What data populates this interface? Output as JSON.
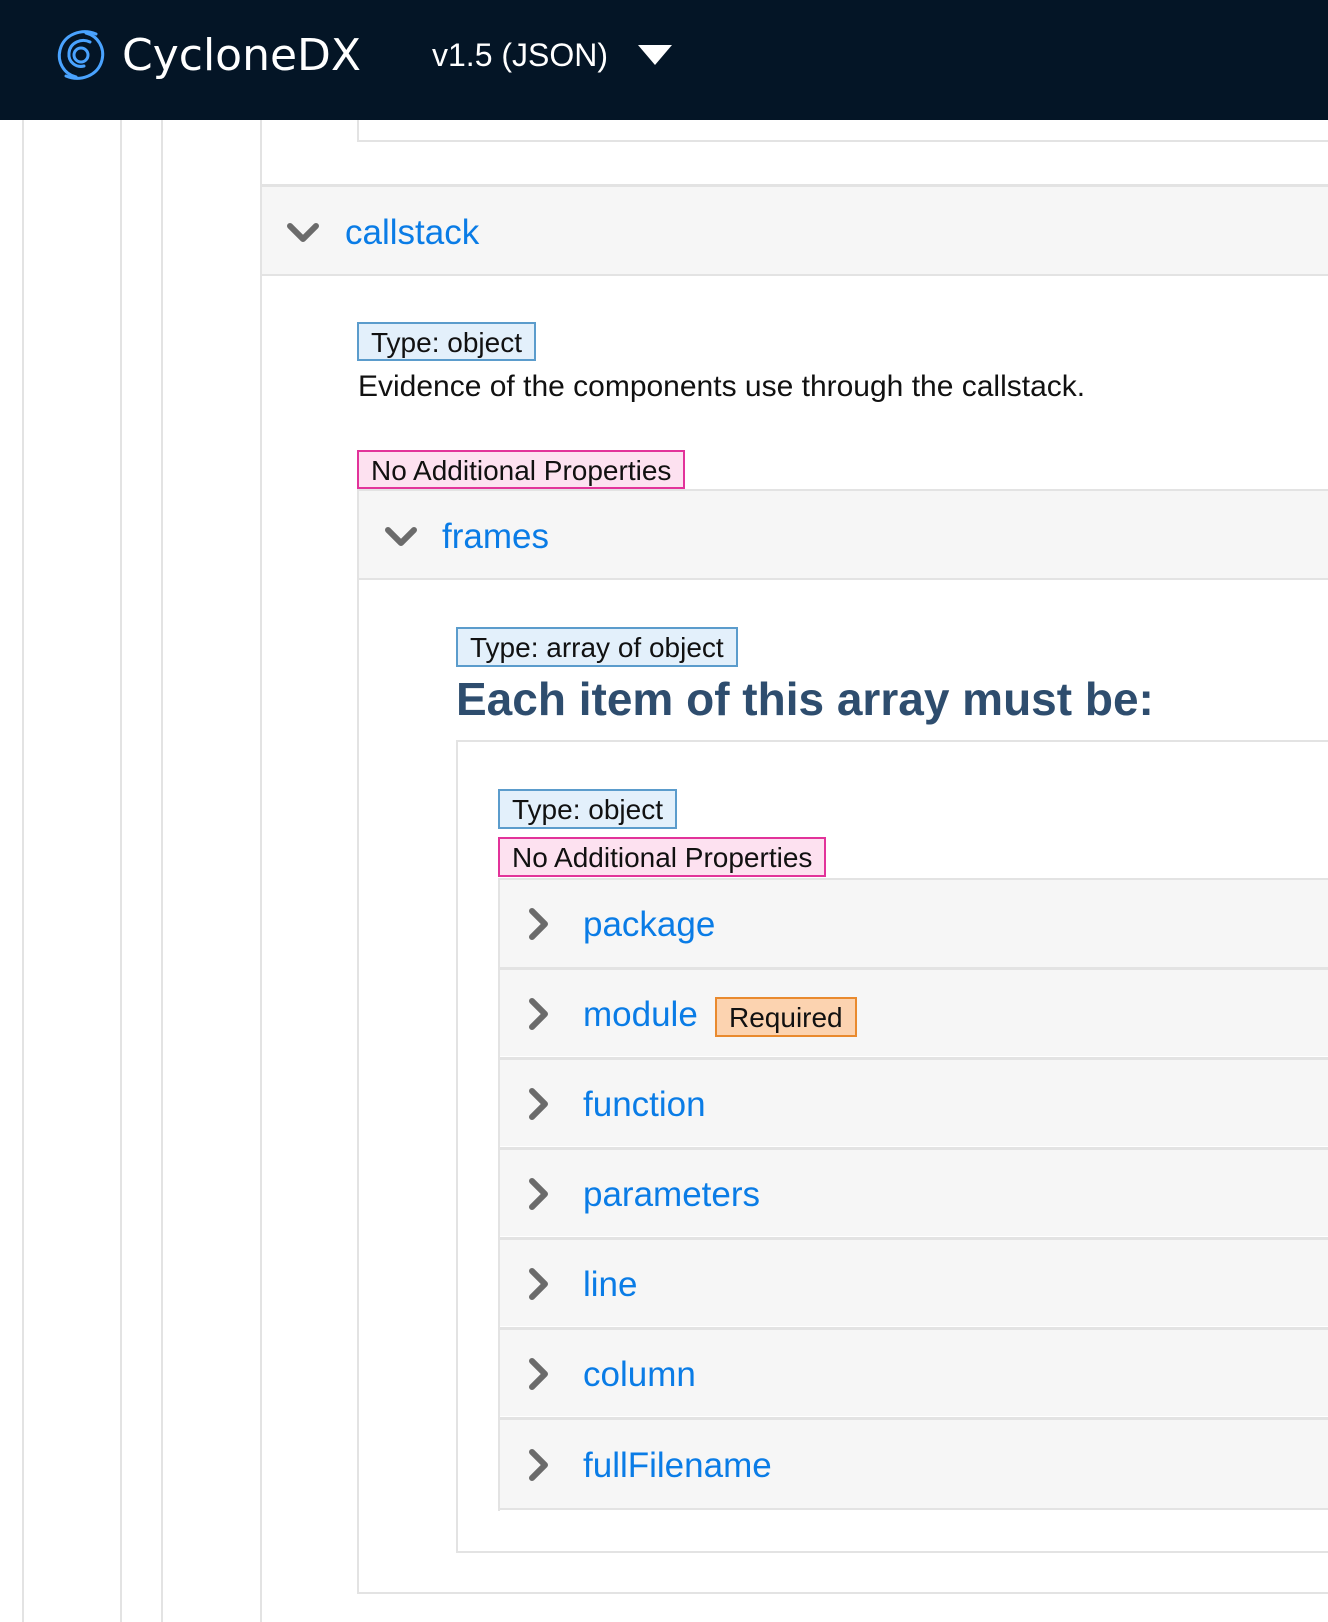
{
  "header": {
    "brand": "CycloneDX",
    "version_label": "v1.5 (JSON)",
    "logo_icon": "cyclonedx-logo-icon",
    "caret_icon": "caret-down-icon"
  },
  "callstack": {
    "name": "callstack",
    "type_badge": "Type: object",
    "description": "Evidence of the components use through the callstack.",
    "no_additional": "No Additional Properties",
    "expanded": true
  },
  "frames": {
    "name": "frames",
    "type_badge": "Type: array of object",
    "items_heading": "Each item of this array must be:",
    "expanded": true,
    "item": {
      "type_badge": "Type: object",
      "no_additional": "No Additional Properties",
      "properties": [
        {
          "name": "package"
        },
        {
          "name": "module",
          "required": "Required"
        },
        {
          "name": "function"
        },
        {
          "name": "parameters"
        },
        {
          "name": "line"
        },
        {
          "name": "column"
        },
        {
          "name": "fullFilename"
        }
      ]
    }
  },
  "colors": {
    "header_bg": "#041526",
    "link": "#0a7ce6",
    "heading": "#2e4d6e",
    "type_badge_border": "#5b9ccc",
    "noadd_badge_border": "#e2339a",
    "required_badge_border": "#e98a2e"
  }
}
